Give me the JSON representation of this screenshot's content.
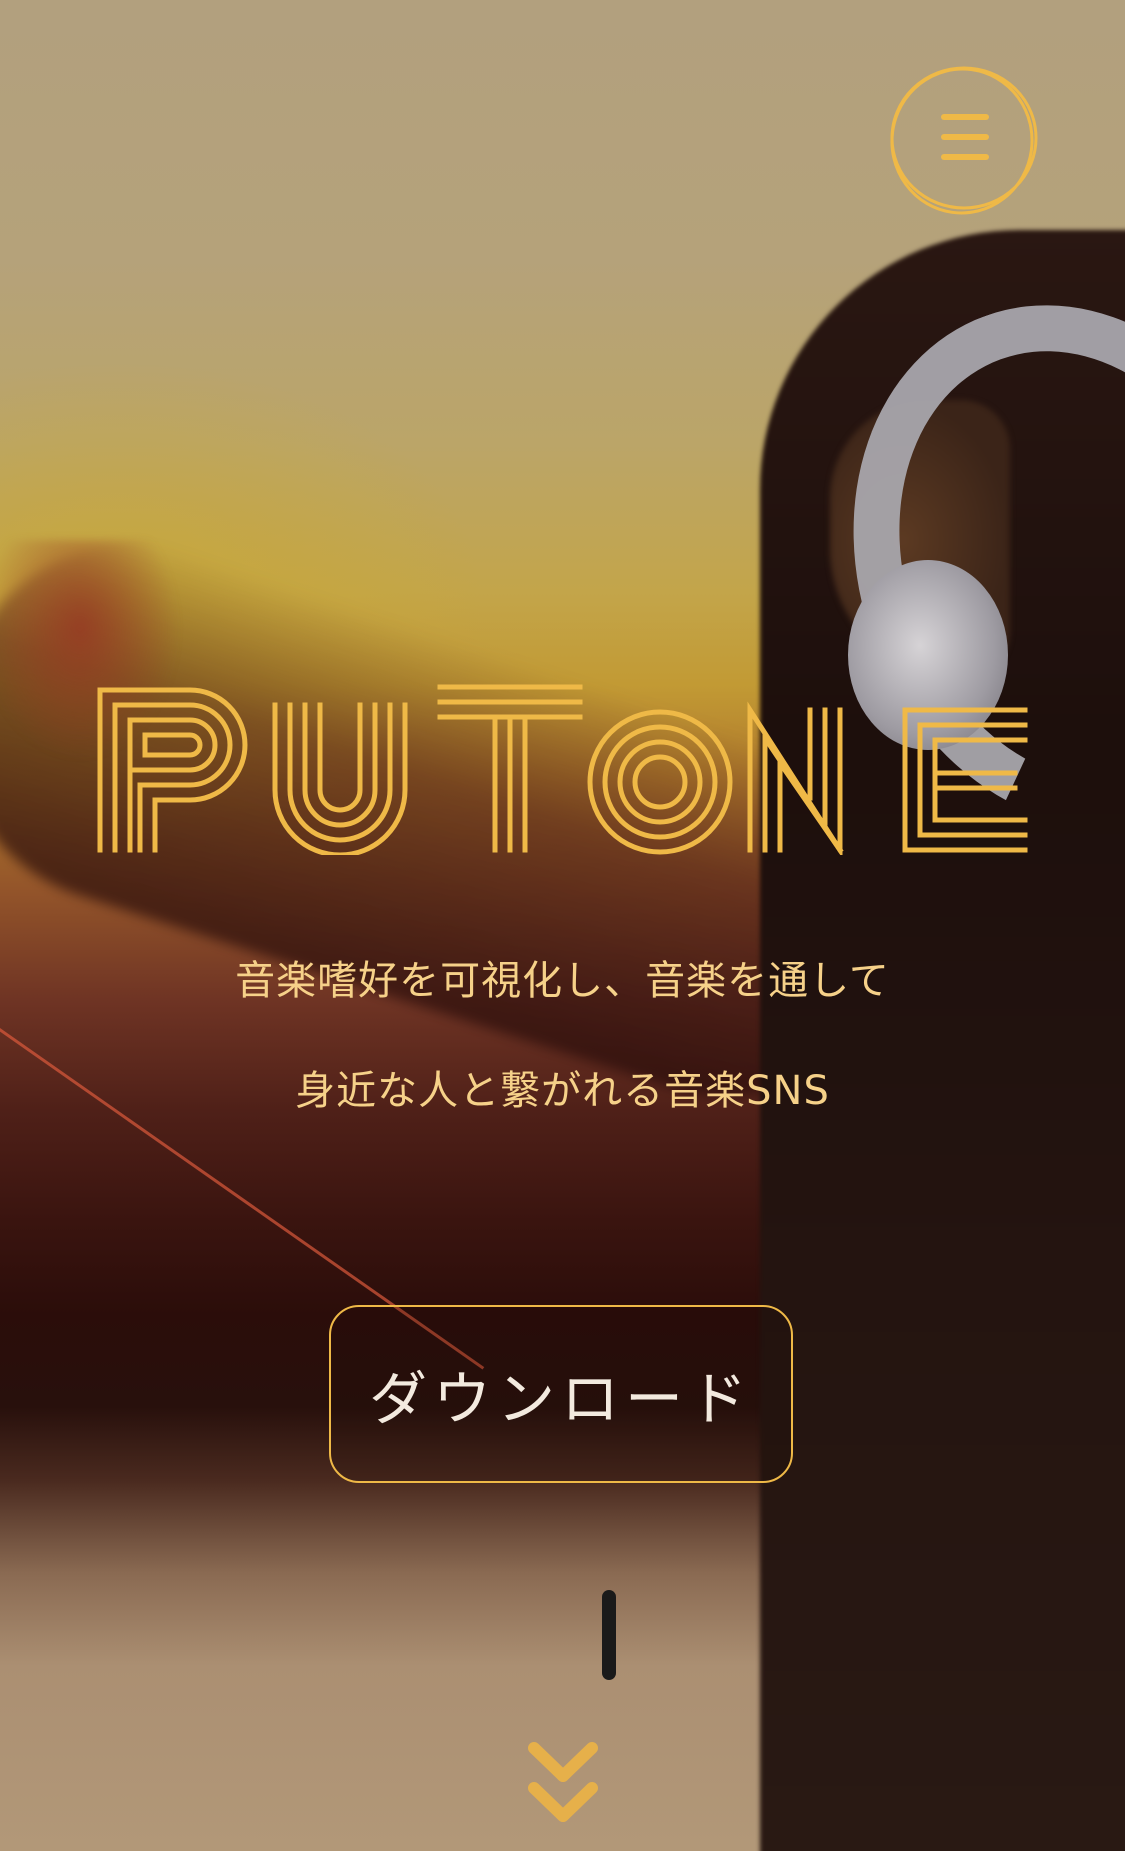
{
  "brand": {
    "logo_text": "PUTONE"
  },
  "nav": {
    "menu_icon": "hamburger-menu-icon"
  },
  "hero": {
    "tagline_line_1": "音楽嗜好を可視化し、音楽を通して",
    "tagline_line_2": "身近な人と繋がれる音楽SNS",
    "download_label": "ダウンロード",
    "scroll_icon": "double-chevron-down-icon"
  },
  "colors": {
    "accent": "#efb947",
    "tagline": "#f6d189",
    "button_text": "#f3eadf"
  }
}
